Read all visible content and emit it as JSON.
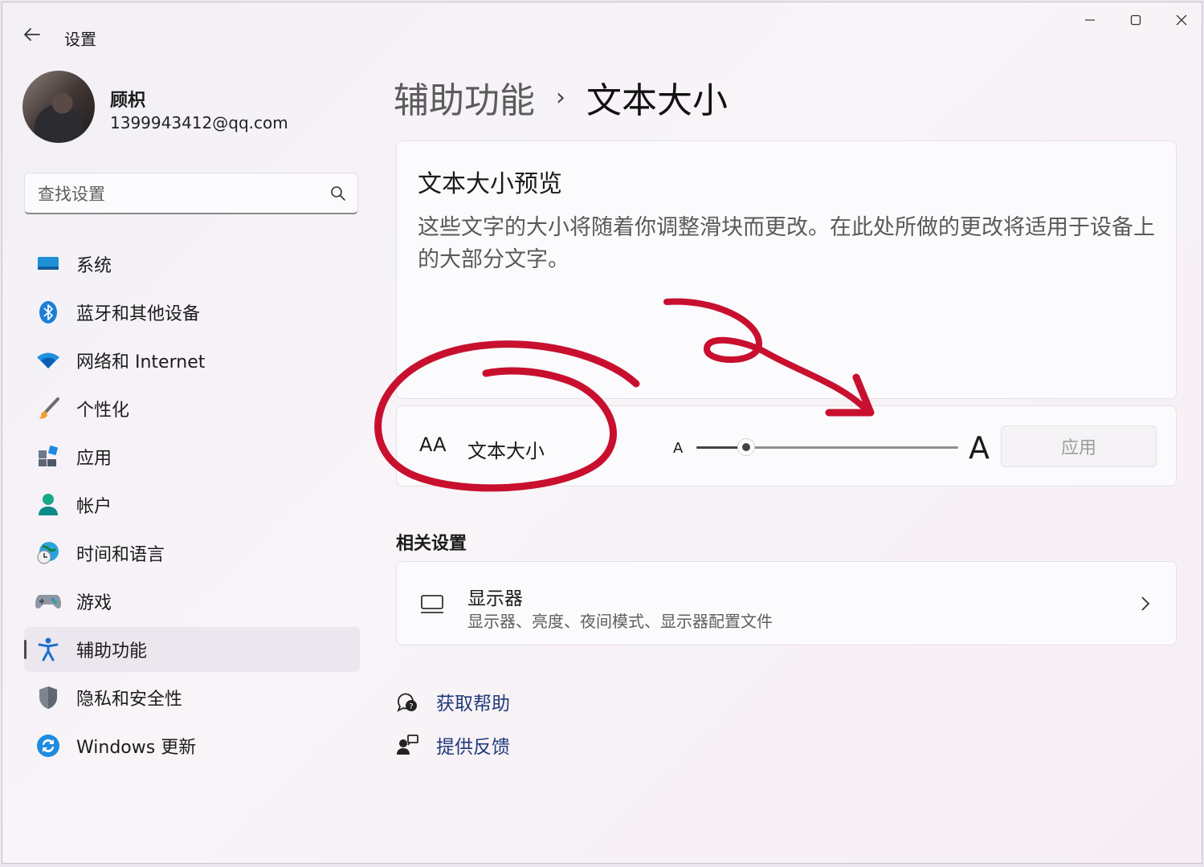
{
  "app": {
    "title": "设置"
  },
  "profile": {
    "name": "顾枳",
    "email": "1399943412@qq.com"
  },
  "search": {
    "placeholder": "查找设置"
  },
  "sidebar": {
    "items": [
      {
        "label": "系统",
        "icon": "system-icon"
      },
      {
        "label": "蓝牙和其他设备",
        "icon": "bluetooth-icon"
      },
      {
        "label": "网络和 Internet",
        "icon": "wifi-icon"
      },
      {
        "label": "个性化",
        "icon": "brush-icon"
      },
      {
        "label": "应用",
        "icon": "apps-icon"
      },
      {
        "label": "帐户",
        "icon": "account-icon"
      },
      {
        "label": "时间和语言",
        "icon": "time-language-icon"
      },
      {
        "label": "游戏",
        "icon": "gamepad-icon"
      },
      {
        "label": "辅助功能",
        "icon": "accessibility-icon",
        "active": true
      },
      {
        "label": "隐私和安全性",
        "icon": "shield-icon"
      },
      {
        "label": "Windows 更新",
        "icon": "update-icon"
      }
    ]
  },
  "breadcrumb": {
    "parent": "辅助功能",
    "separator": "›",
    "current": "文本大小"
  },
  "preview": {
    "title": "文本大小预览",
    "text": "这些文字的大小将随着你调整滑块而更改。在此处所做的更改将适用于设备上的大部分文字。"
  },
  "text_size": {
    "icon_glyph": "AA",
    "label": "文本大小",
    "min_label": "A",
    "max_label": "A",
    "value_fraction": 0.19,
    "apply_label": "应用"
  },
  "related": {
    "title": "相关设置",
    "display": {
      "title": "显示器",
      "subtitle": "显示器、亮度、夜间模式、显示器配置文件"
    }
  },
  "help": {
    "get_help": "获取帮助",
    "feedback": "提供反馈"
  },
  "colors": {
    "accent": "#0067c0",
    "annotation": "#c8102e",
    "link": "#1f3a7a"
  }
}
